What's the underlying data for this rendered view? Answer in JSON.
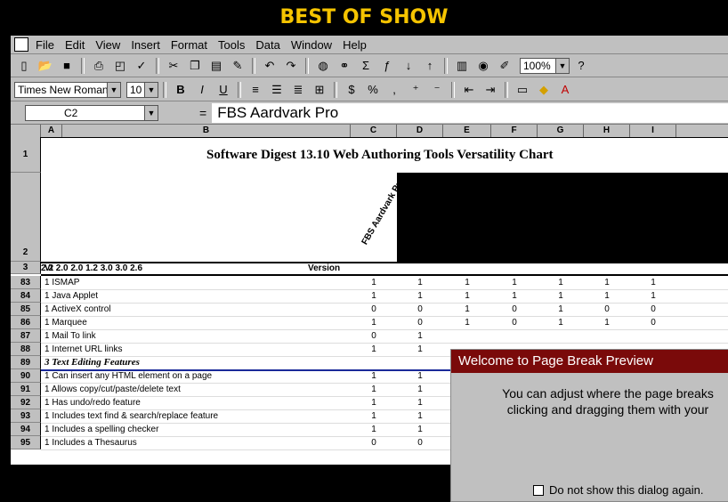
{
  "banner": {
    "title": "BEST OF SHOW",
    "color": "#f5c400"
  },
  "menubar": [
    "File",
    "Edit",
    "View",
    "Insert",
    "Format",
    "Tools",
    "Data",
    "Window",
    "Help"
  ],
  "toolbar": {
    "zoom": "100%"
  },
  "formatting": {
    "font": "Times New Roman",
    "size": "10",
    "bold": "B",
    "italic": "I",
    "underline": "U"
  },
  "formula_bar": {
    "cell_ref": "C2",
    "eq": "=",
    "value": "FBS Aardvark Pro"
  },
  "columns": [
    "A",
    "B",
    "C",
    "D",
    "E",
    "F",
    "G",
    "H",
    "I"
  ],
  "sheet": {
    "title": "Software Digest 13.10 Web Authoring Tools Versatility Chart",
    "first_product": "FBS Aardvark Pro",
    "version_label": "Version",
    "versions": [
      "2.2",
      "2.0",
      "2.0",
      "1.2",
      "3.0",
      "3.0",
      "2.6"
    ],
    "header_rows": [
      "1",
      "2",
      "3"
    ],
    "rows": [
      {
        "row": "83",
        "label": "1 ISMAP",
        "values": [
          "1",
          "1",
          "1",
          "1",
          "1",
          "1",
          "1"
        ]
      },
      {
        "row": "84",
        "label": "1 Java Applet",
        "values": [
          "1",
          "1",
          "1",
          "1",
          "1",
          "1",
          "1"
        ]
      },
      {
        "row": "85",
        "label": "1 ActiveX control",
        "values": [
          "0",
          "0",
          "1",
          "0",
          "1",
          "0",
          "0"
        ]
      },
      {
        "row": "86",
        "label": "1 Marquee",
        "values": [
          "1",
          "0",
          "1",
          "0",
          "1",
          "1",
          "0"
        ]
      },
      {
        "row": "87",
        "label": "1 Mail To link",
        "values": [
          "0",
          "1",
          "",
          "",
          "",
          "",
          ""
        ]
      },
      {
        "row": "88",
        "label": "1 Internet URL links",
        "values": [
          "1",
          "1",
          "",
          "",
          "",
          "",
          ""
        ]
      },
      {
        "row": "89",
        "label": "3 Text Editing Features",
        "values": [
          "",
          "",
          "",
          "",
          "",
          "",
          ""
        ],
        "section": true
      },
      {
        "row": "90",
        "label": "1 Can insert any HTML element on a page",
        "values": [
          "1",
          "1",
          "",
          "",
          "",
          "",
          ""
        ]
      },
      {
        "row": "91",
        "label": "1 Allows copy/cut/paste/delete text",
        "values": [
          "1",
          "1",
          "",
          "",
          "",
          "",
          ""
        ]
      },
      {
        "row": "92",
        "label": "1 Has undo/redo feature",
        "values": [
          "1",
          "1",
          "",
          "",
          "",
          "",
          ""
        ]
      },
      {
        "row": "93",
        "label": "1 Includes text find & search/replace feature",
        "values": [
          "1",
          "1",
          "",
          "",
          "",
          "",
          ""
        ]
      },
      {
        "row": "94",
        "label": "1 Includes a spelling checker",
        "values": [
          "1",
          "1",
          "",
          "",
          "",
          "",
          ""
        ]
      },
      {
        "row": "95",
        "label": "1 Includes a Thesaurus",
        "values": [
          "0",
          "0",
          "",
          "",
          "",
          "",
          ""
        ]
      }
    ]
  },
  "dialog": {
    "title": "Welcome to Page Break Preview",
    "line1": "You can adjust where the page breaks",
    "line2": "clicking and dragging them with your",
    "checkbox": "Do not show this dialog again."
  }
}
